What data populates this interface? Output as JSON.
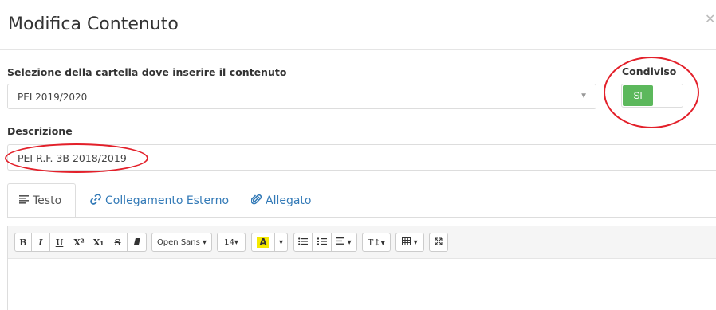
{
  "modal": {
    "title": "Modifica Contenuto",
    "close_icon": "close-icon"
  },
  "folder": {
    "label": "Selezione della cartella dove inserire il contenuto",
    "value": "PEI 2019/2020"
  },
  "shared": {
    "label": "Condiviso",
    "on_label": "SI",
    "color_on": "#5cb85c"
  },
  "description": {
    "label": "Descrizione",
    "value": "PEI R.F. 3B 2018/2019"
  },
  "tabs": [
    {
      "label": "Testo",
      "icon": "text-align-icon",
      "active": true
    },
    {
      "label": "Collegamento Esterno",
      "icon": "link-icon",
      "active": false
    },
    {
      "label": "Allegato",
      "icon": "paperclip-icon",
      "active": false
    }
  ],
  "toolbar": {
    "bold": "B",
    "italic": "I",
    "underline": "U",
    "superscript": "X²",
    "subscript": "X₁",
    "strike": "S",
    "font_family": "Open Sans ▾",
    "font_size": "14▾",
    "highlight": "A",
    "text_size_icon": "T↕▾",
    "highlight_color": "#f5e900"
  },
  "annotation_color": "#e3202a"
}
